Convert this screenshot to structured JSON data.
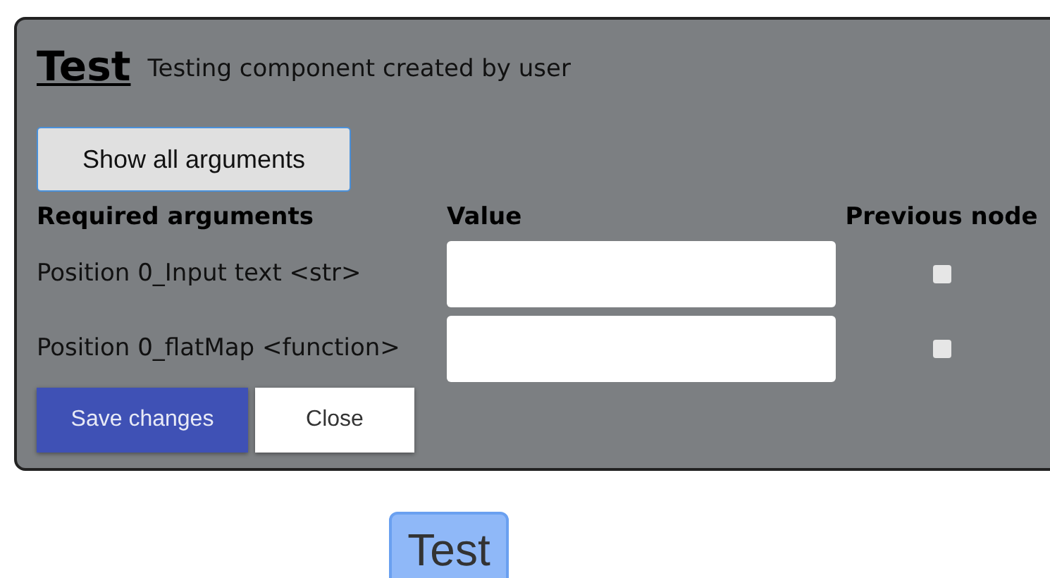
{
  "dialog": {
    "title": "Test",
    "subtitle": "Testing component created by user",
    "show_all_button": "Show all arguments",
    "columns": [
      "Required arguments",
      "Value",
      "Previous node"
    ],
    "rows": [
      {
        "label": "Position 0_Input text <str>",
        "value": "",
        "checked": false
      },
      {
        "label": "Position 0_flatMap <function>",
        "value": "",
        "checked": false
      }
    ],
    "buttons": [
      {
        "label": "Save changes",
        "kind": "primary"
      },
      {
        "label": "Close",
        "kind": "secondary"
      }
    ]
  },
  "node": {
    "label": "Test"
  }
}
